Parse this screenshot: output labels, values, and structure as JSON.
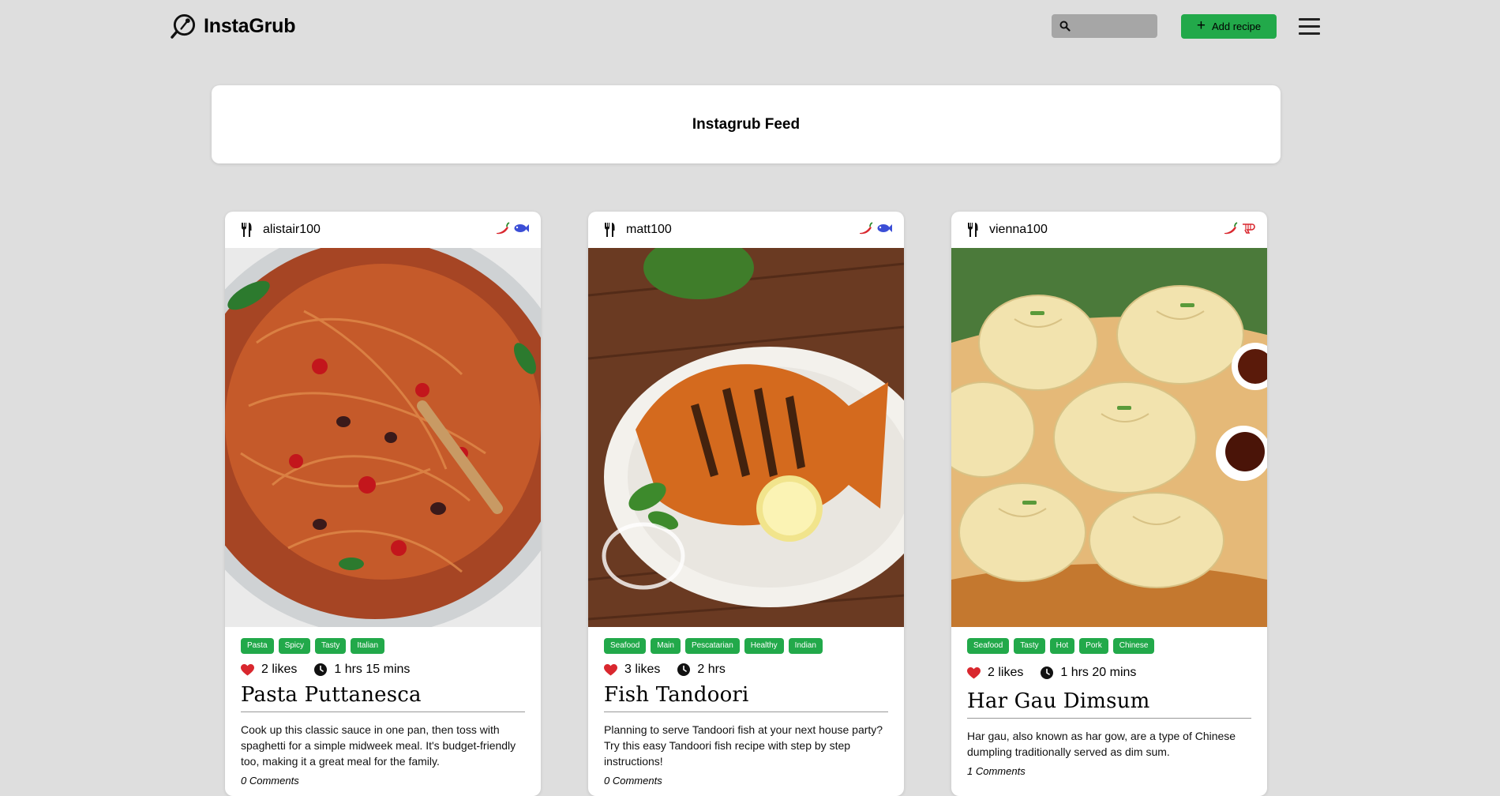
{
  "app": {
    "name": "InstaGrub",
    "search_placeholder": "",
    "add_recipe_label": "Add recipe",
    "accent_color": "#22a94a"
  },
  "feed": {
    "title": "Instagrub Feed"
  },
  "cards": [
    {
      "user": "alistair100",
      "diet_icons": [
        "chili-pepper-icon",
        "fish-icon"
      ],
      "tags": [
        "Pasta",
        "Spicy",
        "Tasty",
        "Italian"
      ],
      "likes": "2 likes",
      "time": "1 hrs 15 mins",
      "title": "Pasta Puttanesca",
      "description": "Cook up this classic sauce in one pan, then toss with spaghetti for a simple midweek meal. It's budget-friendly too, making it a great meal for the family.",
      "comments": "0 Comments"
    },
    {
      "user": "matt100",
      "diet_icons": [
        "chili-pepper-icon",
        "fish-icon"
      ],
      "tags": [
        "Seafood",
        "Main",
        "Pescatarian",
        "Healthy",
        "Indian"
      ],
      "likes": "3 likes",
      "time": "2 hrs",
      "title": "Fish Tandoori",
      "description": "Planning to serve Tandoori fish at your next house party? Try this easy Tandoori fish recipe with step by step instructions!",
      "comments": "0 Comments"
    },
    {
      "user": "vienna100",
      "diet_icons": [
        "chili-pepper-icon",
        "shrimp-icon"
      ],
      "tags": [
        "Seafood",
        "Tasty",
        "Hot",
        "Pork",
        "Chinese"
      ],
      "likes": "2 likes",
      "time": "1 hrs 20 mins",
      "title": "Har Gau Dimsum",
      "description": "Har gau, also known as har gow, are a type of Chinese dumpling traditionally served as dim sum.",
      "comments": "1 Comments"
    }
  ]
}
